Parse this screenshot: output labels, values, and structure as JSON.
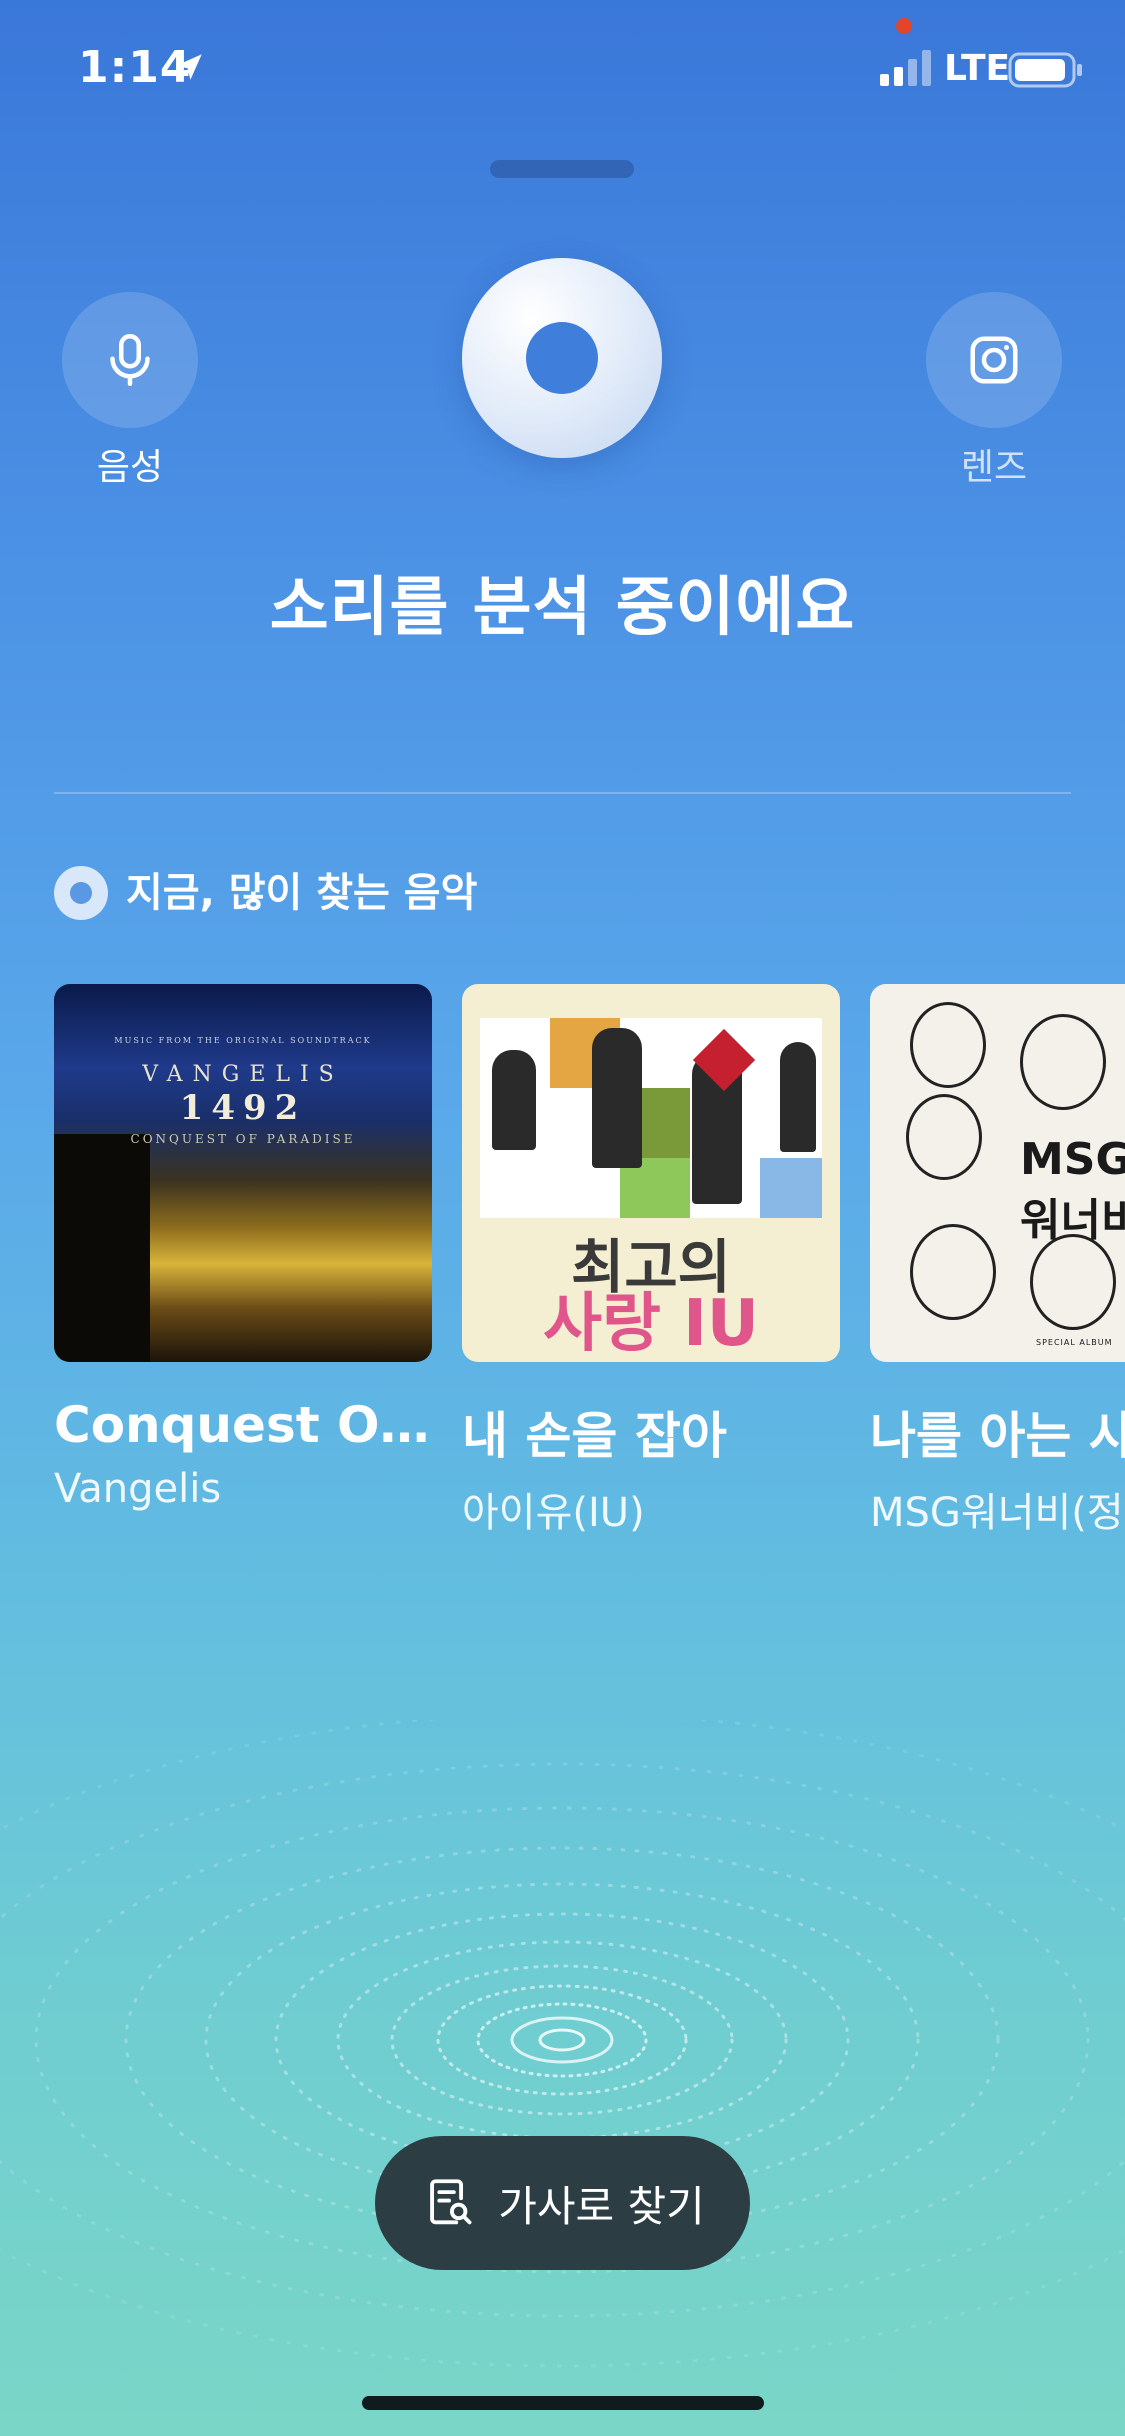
{
  "status_bar": {
    "time": "1:14",
    "network": "LTE",
    "location_icon": "location-arrow-icon",
    "signal_icon": "signal-bars-icon",
    "battery_icon": "battery-icon"
  },
  "search_modes": {
    "voice_label": "음성",
    "lens_label": "렌즈",
    "voice_icon": "microphone-icon",
    "lens_icon": "camera-lens-icon"
  },
  "status_text": "소리를 분석 중이에요",
  "trending": {
    "title": "지금, 많이 찾는 음악",
    "items": [
      {
        "title": "Conquest Of...",
        "artist": "Vangelis",
        "art_text": {
          "top": "MUSIC FROM THE ORIGINAL SOUNDTRACK",
          "name": "VANGELIS",
          "number": "1492",
          "subtitle": "CONQUEST OF PARADISE"
        }
      },
      {
        "title": "내 손을 잡아",
        "artist": "아이유(IU)",
        "art_text": {
          "line1": "최고의",
          "line2": "사랑 IU"
        }
      },
      {
        "title": "나를 아는 사람",
        "artist": "MSG워너비(정",
        "art_text": {
          "line1": "MSG",
          "line2": "워너비",
          "footer": "SPECIAL ALBUM"
        }
      }
    ]
  },
  "lyrics_button": {
    "label": "가사로 찾기",
    "icon": "document-search-icon"
  },
  "colors": {
    "gradient_top": "#3a77d9",
    "gradient_bottom": "#7ad6c6",
    "lyrics_button_bg": "#2c3e44"
  }
}
